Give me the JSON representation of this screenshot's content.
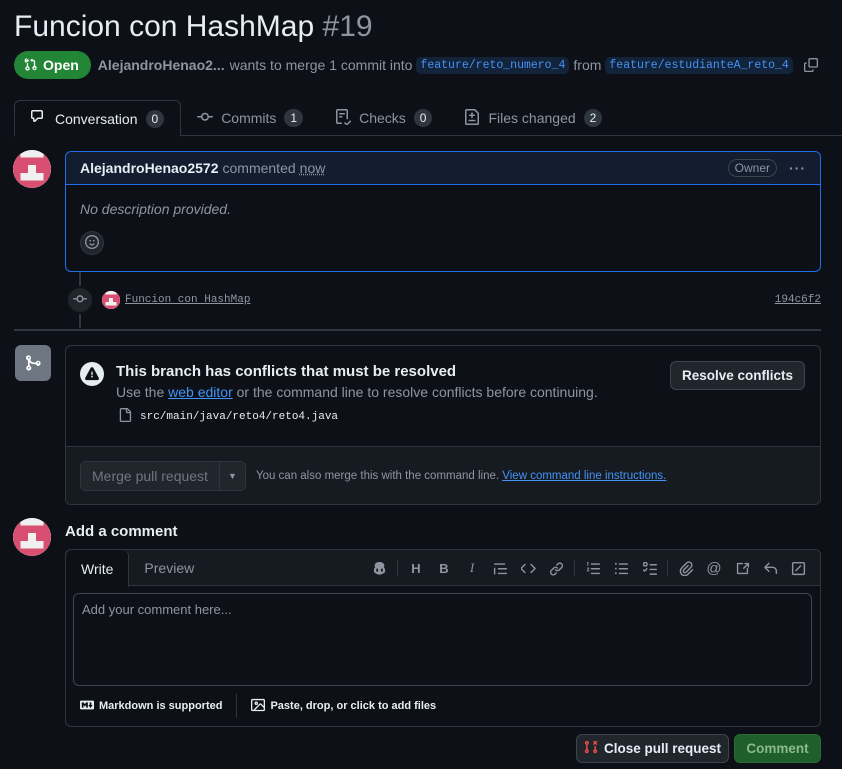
{
  "header": {
    "title": "Funcion con HashMap",
    "number": "#19",
    "state": "Open",
    "author": "AlejandroHenao2...",
    "merge_text": "wants to merge 1 commit into",
    "base_branch": "feature/reto_numero_4",
    "from_text": "from",
    "head_branch": "feature/estudianteA_reto_4"
  },
  "tabs": [
    {
      "label": "Conversation",
      "count": "0"
    },
    {
      "label": "Commits",
      "count": "1"
    },
    {
      "label": "Checks",
      "count": "0"
    },
    {
      "label": "Files changed",
      "count": "2"
    }
  ],
  "comment": {
    "author": "AlejandroHenao2572",
    "action": "commented",
    "time": "now",
    "badge": "Owner",
    "body": "No description provided."
  },
  "commit": {
    "message": "Funcion con HashMap",
    "sha": "194c6f2"
  },
  "merge": {
    "title": "This branch has conflicts that must be resolved",
    "sub_prefix": "Use the",
    "sub_link": "web editor",
    "sub_suffix": "or the command line to resolve conflicts before continuing.",
    "file": "src/main/java/reto4/reto4.java",
    "resolve_label": "Resolve conflicts",
    "merge_label": "Merge pull request",
    "hint_text": "You can also merge this with the command line.",
    "hint_link": "View command line instructions."
  },
  "add_comment": {
    "title": "Add a comment",
    "write_tab": "Write",
    "preview_tab": "Preview",
    "placeholder": "Add your comment here...",
    "markdown_note": "Markdown is supported",
    "attach_note": "Paste, drop, or click to add files",
    "close_label": "Close pull request",
    "comment_label": "Comment"
  },
  "colors": {
    "open_green": "#238636",
    "link_blue": "#4493f8",
    "avatar_pink": "#d94f72"
  }
}
